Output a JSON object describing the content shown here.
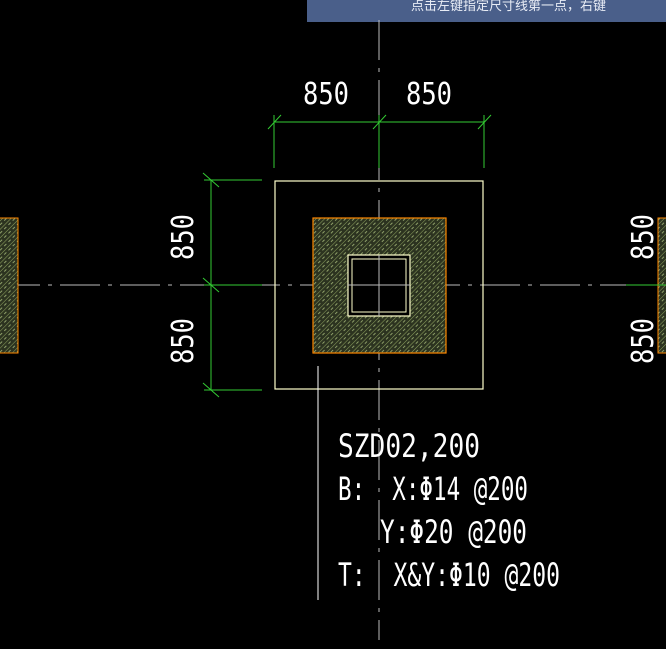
{
  "prompt": {
    "text": "点击左键指定尺寸线第一点，右键"
  },
  "dimensions": {
    "top_left": "850",
    "top_right": "850",
    "left_top": "850",
    "left_bottom": "850",
    "right_top": "850",
    "right_bottom": "850"
  },
  "annotation": {
    "line1": "SZD02,200",
    "line2": "B:  X:Φ14 @200",
    "line3": "Y:Φ20 @200",
    "line4": "T:  X&Y:Φ10 @200"
  },
  "colors": {
    "background": "#000000",
    "dimension": "#33cc33",
    "outline": "#ffffcc",
    "column_edge": "#ff8800",
    "hatch": "#ccee88",
    "axis": "#bbbbbb",
    "text": "#ffffff",
    "prompt_bg": "#4a5f8a"
  }
}
